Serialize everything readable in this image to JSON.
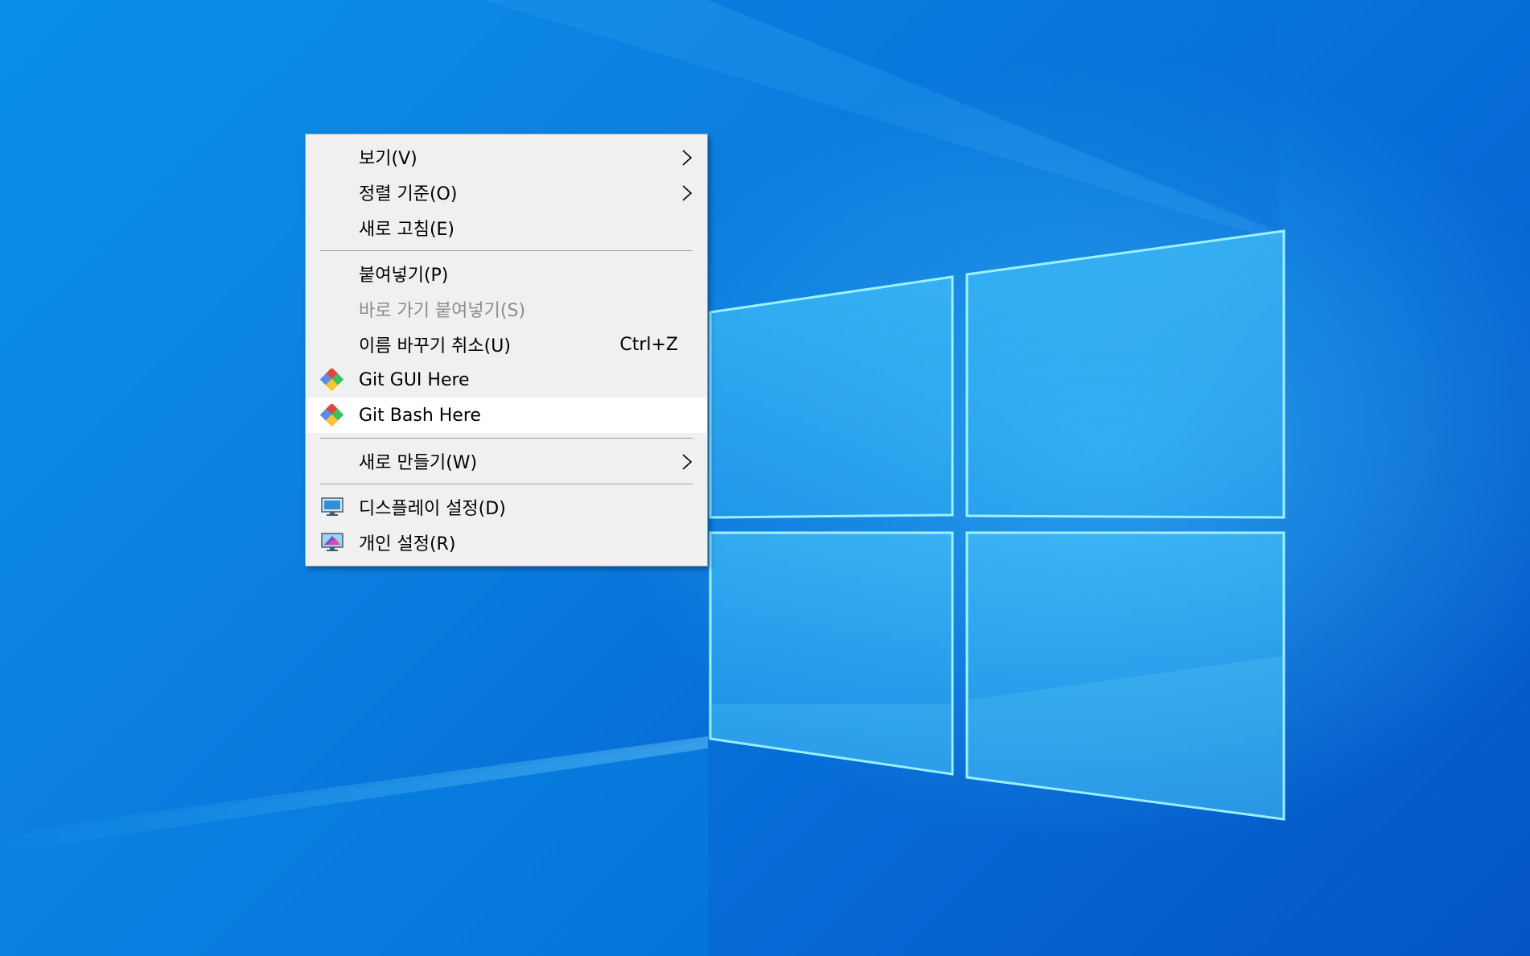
{
  "desktop": {
    "accent_color": "#0a8fe8"
  },
  "context_menu": {
    "groups": [
      [
        {
          "label": "보기(V)",
          "submenu": true
        },
        {
          "label": "정렬 기준(O)",
          "submenu": true
        },
        {
          "label": "새로 고침(E)"
        }
      ],
      [
        {
          "label": "붙여넣기(P)"
        },
        {
          "label": "바로 가기 붙여넣기(S)",
          "disabled": true
        },
        {
          "label": "이름 바꾸기 취소(U)",
          "shortcut": "Ctrl+Z"
        },
        {
          "label": "Git GUI Here",
          "icon": "git-gui-icon"
        },
        {
          "label": "Git Bash Here",
          "icon": "git-bash-icon",
          "highlighted": true
        }
      ],
      [
        {
          "label": "새로 만들기(W)",
          "submenu": true
        }
      ],
      [
        {
          "label": "디스플레이 설정(D)",
          "icon": "display-settings-icon"
        },
        {
          "label": "개인 설정(R)",
          "icon": "personalize-icon"
        }
      ]
    ]
  }
}
